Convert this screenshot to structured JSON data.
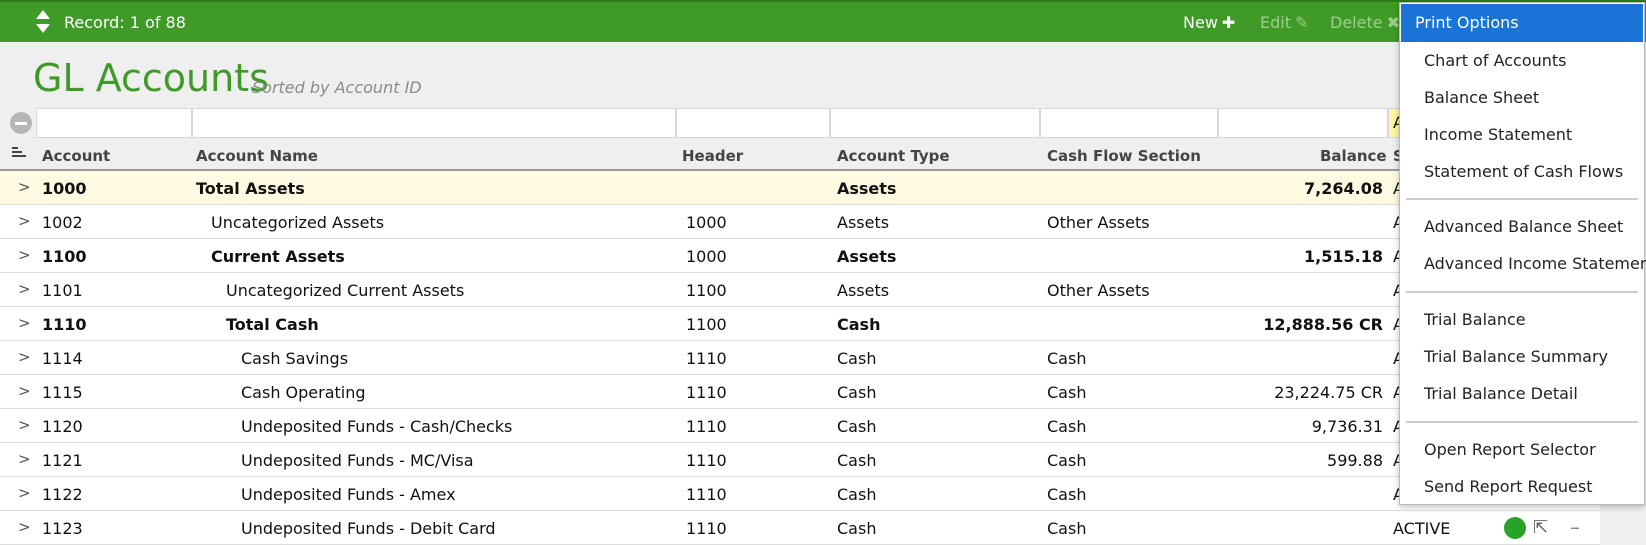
{
  "toolbar": {
    "record_label": "Record: 1 of 88",
    "new_label": "New",
    "edit_label": "Edit",
    "delete_label": "Delete"
  },
  "page": {
    "title": "GL Accounts",
    "subtitle": "Sorted by Account ID"
  },
  "filter": {
    "balance_filter_partial": "A"
  },
  "columns": {
    "account": "Account",
    "account_name": "Account Name",
    "header": "Header",
    "account_type": "Account Type",
    "cash_flow_section": "Cash Flow Section",
    "balance": "Balance",
    "status_partial": "S"
  },
  "rows": [
    {
      "account": "1000",
      "name": "Total Assets",
      "header": "",
      "type": "Assets",
      "cash_flow": "",
      "balance": "7,264.08",
      "status": "A",
      "bold": true,
      "indent": 0
    },
    {
      "account": "1002",
      "name": "Uncategorized Assets",
      "header": "1000",
      "type": "Assets",
      "cash_flow": "Other Assets",
      "balance": "",
      "status": "A",
      "bold": false,
      "indent": 1
    },
    {
      "account": "1100",
      "name": "Current Assets",
      "header": "1000",
      "type": "Assets",
      "cash_flow": "",
      "balance": "1,515.18",
      "status": "A",
      "bold": true,
      "indent": 1
    },
    {
      "account": "1101",
      "name": "Uncategorized Current Assets",
      "header": "1100",
      "type": "Assets",
      "cash_flow": "Other Assets",
      "balance": "",
      "status": "A",
      "bold": false,
      "indent": 2
    },
    {
      "account": "1110",
      "name": "Total Cash",
      "header": "1100",
      "type": "Cash",
      "cash_flow": "",
      "balance": "12,888.56 CR",
      "status": "A",
      "bold": true,
      "indent": 2
    },
    {
      "account": "1114",
      "name": "Cash Savings",
      "header": "1110",
      "type": "Cash",
      "cash_flow": "Cash",
      "balance": "",
      "status": "A",
      "bold": false,
      "indent": 3
    },
    {
      "account": "1115",
      "name": "Cash Operating",
      "header": "1110",
      "type": "Cash",
      "cash_flow": "Cash",
      "balance": "23,224.75 CR",
      "status": "A",
      "bold": false,
      "indent": 3
    },
    {
      "account": "1120",
      "name": "Undeposited Funds - Cash/Checks",
      "header": "1110",
      "type": "Cash",
      "cash_flow": "Cash",
      "balance": "9,736.31",
      "status": "A",
      "bold": false,
      "indent": 3
    },
    {
      "account": "1121",
      "name": "Undeposited Funds - MC/Visa",
      "header": "1110",
      "type": "Cash",
      "cash_flow": "Cash",
      "balance": "599.88",
      "status": "A",
      "bold": false,
      "indent": 3
    },
    {
      "account": "1122",
      "name": "Undeposited Funds - Amex",
      "header": "1110",
      "type": "Cash",
      "cash_flow": "Cash",
      "balance": "",
      "status": "A",
      "bold": false,
      "indent": 3
    },
    {
      "account": "1123",
      "name": "Undeposited Funds - Debit Card",
      "header": "1110",
      "type": "Cash",
      "cash_flow": "Cash",
      "balance": "",
      "status": "ACTIVE",
      "bold": false,
      "indent": 3
    }
  ],
  "chevron": ">",
  "menu": {
    "items": [
      {
        "label": "Print Options",
        "active": true
      },
      {
        "label": "Chart of Accounts"
      },
      {
        "label": "Balance Sheet"
      },
      {
        "label": "Income Statement"
      },
      {
        "label": "Statement of Cash Flows"
      },
      {
        "label": "Advanced Balance Sheet"
      },
      {
        "label": "Advanced Income Statement"
      },
      {
        "label": "Trial Balance"
      },
      {
        "label": "Trial Balance Summary"
      },
      {
        "label": "Trial Balance Detail"
      },
      {
        "label": "Open Report Selector"
      },
      {
        "label": "Send Report Request"
      }
    ]
  },
  "colors": {
    "brand_green": "#3f9a27",
    "menu_highlight": "#1a73d6",
    "status_active": "#28a228"
  },
  "icons": {
    "record_nav": "up-down-arrows-icon",
    "new": "plus-icon",
    "edit": "pencil-icon",
    "delete": "x-icon"
  }
}
